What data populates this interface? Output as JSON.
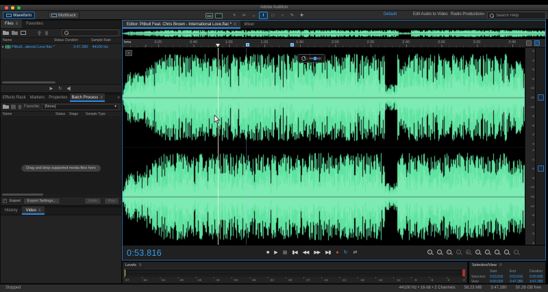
{
  "titlebar": {
    "app_title": "Adobe Audition"
  },
  "toolbar": {
    "waveform": "Waveform",
    "multitrack": "Multitrack",
    "workspace": "Default",
    "ws_edit_audio_to_video": "Edit Audio to Video",
    "ws_radio_production": "Radio Production",
    "overflow": "»",
    "search_placeholder": "Search Help",
    "tools": [
      {
        "name": "move-tool-button",
        "glyph": "↖"
      },
      {
        "name": "razor-tool-button",
        "glyph": "✂"
      },
      {
        "name": "slip-tool-button",
        "glyph": "↔"
      },
      {
        "name": "time-selection-tool-button",
        "glyph": "I"
      },
      {
        "name": "marquee-selection-tool-button",
        "glyph": "□"
      },
      {
        "name": "lasso-selection-tool-button",
        "glyph": "○"
      },
      {
        "name": "paintbrush-selection-tool-button",
        "glyph": "✎"
      },
      {
        "name": "spot-healing-brush-tool-button",
        "glyph": "✚"
      }
    ]
  },
  "files_panel": {
    "tab_files": "Files",
    "tab_favorites": "Favorites",
    "menu_glyph": "≡",
    "columns": [
      "Name",
      "Status",
      "Duration",
      "Sample Rate"
    ],
    "file": {
      "disclosure": "▸",
      "name": "Pitbull...ational Love.flac *",
      "duration": "3:47.280",
      "sample_rate": "44100 Hz"
    },
    "play_glyph": "▶",
    "loop_glyph": "↻"
  },
  "batch_panel": {
    "tab_effects_rack": "Effects Rack",
    "tab_markers": "Markers",
    "tab_properties": "Properties",
    "tab_batch_process": "Batch Process",
    "menu_glyph": "≡",
    "overflow": "»",
    "favorite_label": "Favorite:",
    "favorite_value": "[None]",
    "dropdown_arrow": "▾",
    "columns": [
      "Name",
      "Status",
      "Stage",
      "Sample Type"
    ],
    "empty_message": "Drag and drop supported media files here",
    "export_label": "Export",
    "export_check": "✓",
    "export_settings": "Export Settings...",
    "undo": "Undo",
    "run": "Run"
  },
  "history_panel": {
    "tab_history": "History",
    "tab_video": "Video",
    "menu_glyph": "≡"
  },
  "editor": {
    "tab_label": "Editor: Pitbull Feat. Chris Brown - International Love.flac *",
    "tab_mixer": "Mixer",
    "menu_glyph": "≡",
    "ruler_unit": "hms",
    "ruler_labels": [
      "0:20",
      "0:40",
      "1:00",
      "1:20",
      "1:40",
      "2:00",
      "2:20",
      "2:40",
      "3:00",
      "3:20",
      "3:40"
    ],
    "db_scale_left": [
      "0",
      "-3",
      "-6",
      "-9",
      "-12",
      "-15",
      "-12",
      "-9",
      "-6",
      "-3",
      "0"
    ],
    "db_scale_right": [
      "0",
      "-3",
      "-6",
      "-9",
      "-12",
      "-15",
      "-12",
      "-9",
      "-6",
      "-3",
      "0"
    ],
    "timecode": "0:53.816",
    "transport": [
      {
        "name": "stop-button",
        "glyph": "■"
      },
      {
        "name": "play-button",
        "glyph": "▶"
      },
      {
        "name": "pause-button",
        "glyph": "▮▮"
      },
      {
        "name": "skip-to-start-button",
        "glyph": "▮◀"
      },
      {
        "name": "rewind-button",
        "glyph": "◀◀"
      },
      {
        "name": "fast-forward-button",
        "glyph": "▶▶"
      },
      {
        "name": "skip-to-end-button",
        "glyph": "▶▮"
      },
      {
        "name": "record-button",
        "glyph": "●"
      },
      {
        "name": "loop-playback-button",
        "glyph": "↻"
      },
      {
        "name": "skip-selection-button",
        "glyph": "⇄"
      }
    ],
    "zoom_tools": [
      {
        "name": "zoom-in-time-button",
        "sign": "+"
      },
      {
        "name": "zoom-out-time-button",
        "sign": "-"
      },
      {
        "name": "zoom-in-amplitude-button",
        "sign": "+"
      },
      {
        "name": "zoom-out-amplitude-button",
        "sign": "-",
        "dim": true
      },
      {
        "name": "zoom-to-selection-button",
        "sign": "s",
        "dim": true
      },
      {
        "name": "zoom-in-point-button",
        "sign": "+"
      },
      {
        "name": "zoom-out-point-button",
        "sign": "-"
      },
      {
        "name": "zoom-full-button",
        "sign": ""
      },
      {
        "name": "share-button",
        "sign": ""
      },
      {
        "name": "snap-toggle-button",
        "sign": "",
        "dim": true
      }
    ]
  },
  "levels_panel": {
    "title": "Levels",
    "menu_glyph": "≡",
    "scale": [
      "-57",
      "-54",
      "-51",
      "-48",
      "-45",
      "-42",
      "-39",
      "-36",
      "-33",
      "-30",
      "-27",
      "-24",
      "-21",
      "-18",
      "-15",
      "-12",
      "-9",
      "-6",
      "-3",
      "0"
    ]
  },
  "selection_view": {
    "title": "Selection/View",
    "menu_glyph": "≡",
    "columns": [
      "Start",
      "End",
      "Duration"
    ],
    "rows": [
      {
        "label": "Selection",
        "start": "0:53.816",
        "end": "0:53.816",
        "duration": "0:00.000"
      },
      {
        "label": "View",
        "start": "0:00.000",
        "end": "3:47.280",
        "duration": "3:47.280"
      }
    ]
  },
  "statusbar": {
    "transport_state": "Stopped",
    "format": "44100 Hz • 16-bit • 2 Channels",
    "file_size": "58.23 MB",
    "duration": "3:47.280",
    "free_space": "50.26 GB free"
  },
  "waveform": {
    "color": "#5fe3a1",
    "core_color": "#b9f5d6",
    "background": "#000000",
    "playhead_color": "#efefd2",
    "accent_color": "#2d8ceb",
    "timecode_color": "#32a0f2"
  }
}
